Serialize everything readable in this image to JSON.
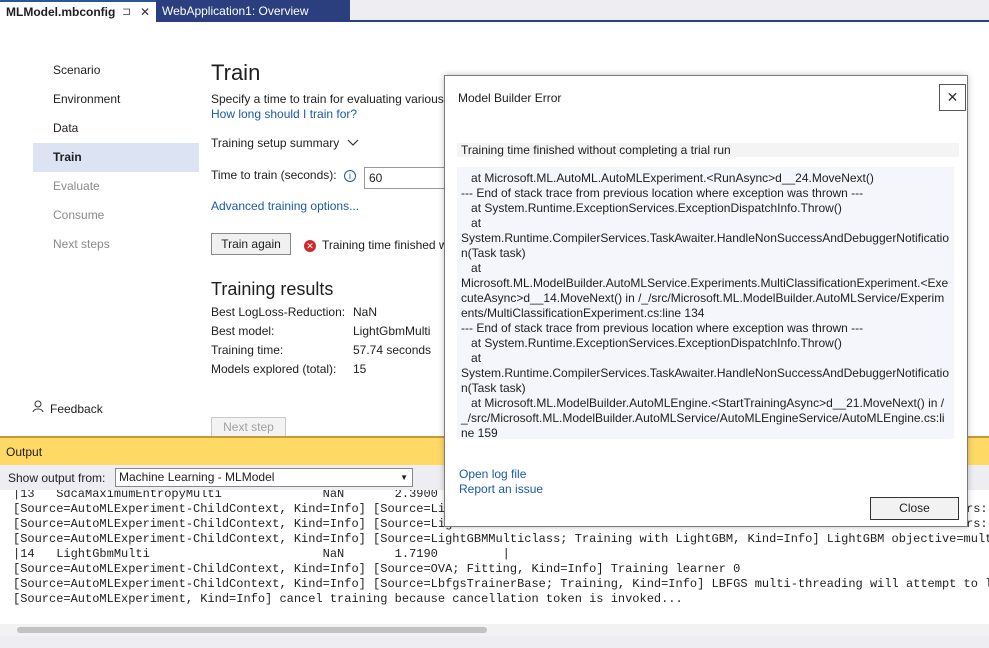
{
  "tabs": [
    {
      "label": "MLModel.mbconfig",
      "pin": "⊐",
      "close": "✕"
    },
    {
      "label": "WebApplication1: Overview"
    }
  ],
  "nav": {
    "items": [
      "Scenario",
      "Environment",
      "Data",
      "Train",
      "Evaluate",
      "Consume",
      "Next steps"
    ],
    "feedback": "Feedback"
  },
  "train": {
    "title": "Train",
    "description": "Specify a time to train for evaluating various",
    "how_long_link": "How long should I train for?",
    "summary": "Training setup summary",
    "time_label": "Time to train (seconds):",
    "time_value": "60",
    "advanced_link": "Advanced training options...",
    "train_again": "Train again",
    "status": "Training time finished w"
  },
  "results": {
    "title": "Training results",
    "rows": [
      {
        "label": "Best LogLoss-Reduction:",
        "value": "NaN"
      },
      {
        "label": "Best model:",
        "value": "LightGbmMulti"
      },
      {
        "label": "Training time:",
        "value": "57.74 seconds"
      },
      {
        "label": "Models explored (total):",
        "value": "15"
      }
    ],
    "next_step": "Next step"
  },
  "output": {
    "title": "Output",
    "show_from_label": "Show output from:",
    "source": "Machine Learning - MLModel",
    "lines": [
      "|13   SdcaMaximumEntropyMulti              NaN       2.3900",
      "[Source=AutoMLExperiment-ChildContext, Kind=Info] [Source=Ligh",
      "[Source=AutoMLExperiment-ChildContext, Kind=Info] [Source=Ligh",
      "[Source=AutoMLExperiment-ChildContext, Kind=Info] [Source=LightGBMMulticlass; Training with LightGBM, Kind=Info] LightGBM objective=multicl",
      "|14   LightGbmMulti                        NaN       1.7190         |",
      "[Source=AutoMLExperiment-ChildContext, Kind=Info] [Source=OVA; Fitting, Kind=Info] Training learner 0",
      "[Source=AutoMLExperiment-ChildContext, Kind=Info] [Source=LbfgsTrainerBase; Training, Kind=Info] LBFGS multi-threading will attempt to load",
      "[Source=AutoMLExperiment, Kind=Info] cancel training because cancellation token is invoked..."
    ],
    "right_fragments": [
      "rs:",
      "rs:"
    ]
  },
  "dialog": {
    "title": "Model Builder Error",
    "message": "Training time finished without completing a trial run",
    "stack_trace": "   at Microsoft.ML.AutoML.AutoMLExperiment.<RunAsync>d__24.MoveNext()\n--- End of stack trace from previous location where exception was thrown ---\n   at System.Runtime.ExceptionServices.ExceptionDispatchInfo.Throw()\n   at\nSystem.Runtime.CompilerServices.TaskAwaiter.HandleNonSuccessAndDebuggerNotification(Task task)\n   at\nMicrosoft.ML.ModelBuilder.AutoMLService.Experiments.MultiClassificationExperiment.<ExecuteAsync>d__14.MoveNext() in /_/src/Microsoft.ML.ModelBuilder.AutoMLService/Experiments/MultiClassificationExperiment.cs:line 134\n--- End of stack trace from previous location where exception was thrown ---\n   at System.Runtime.ExceptionServices.ExceptionDispatchInfo.Throw()\n   at\nSystem.Runtime.CompilerServices.TaskAwaiter.HandleNonSuccessAndDebuggerNotification(Task task)\n   at Microsoft.ML.ModelBuilder.AutoMLEngine.<StartTrainingAsync>d__21.MoveNext() in /_/src/Microsoft.ML.ModelBuilder.AutoMLService/AutoMLEngineService/AutoMLEngine.cs:line 159",
    "open_log": "Open log file",
    "report_issue": "Report an issue",
    "close_button": "Close"
  },
  "colors": {
    "accent": "#1a5aa8",
    "selected_nav": "#dce3f3",
    "output_header": "#ffd966",
    "tab_inactive": "#2b3f7e",
    "error": "#d1292b"
  }
}
